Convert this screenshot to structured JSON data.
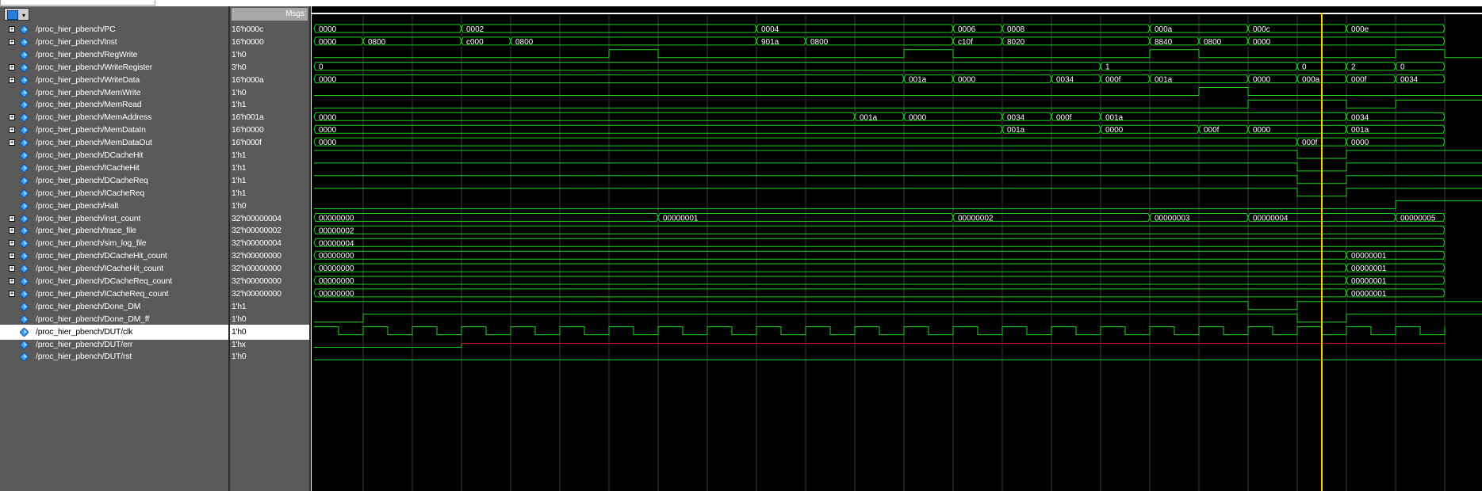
{
  "header": {
    "msgs_label": "Msgs"
  },
  "colors": {
    "wave": "#1fd21f",
    "cursor": "#ffcc00",
    "xstate": "#c81414",
    "grid": "#3c3c3c"
  },
  "signals": [
    {
      "name": "/proc_hier_pbench/PC",
      "value": "16'h000c",
      "expandable": true
    },
    {
      "name": "/proc_hier_pbench/Inst",
      "value": "16'h0000",
      "expandable": true
    },
    {
      "name": "/proc_hier_pbench/RegWrite",
      "value": "1'h0",
      "expandable": false
    },
    {
      "name": "/proc_hier_pbench/WriteRegister",
      "value": "3'h0",
      "expandable": true
    },
    {
      "name": "/proc_hier_pbench/WriteData",
      "value": "16'h000a",
      "expandable": true
    },
    {
      "name": "/proc_hier_pbench/MemWrite",
      "value": "1'h0",
      "expandable": false
    },
    {
      "name": "/proc_hier_pbench/MemRead",
      "value": "1'h1",
      "expandable": false
    },
    {
      "name": "/proc_hier_pbench/MemAddress",
      "value": "16'h001a",
      "expandable": true
    },
    {
      "name": "/proc_hier_pbench/MemDataIn",
      "value": "16'h0000",
      "expandable": true
    },
    {
      "name": "/proc_hier_pbench/MemDataOut",
      "value": "16'h000f",
      "expandable": true
    },
    {
      "name": "/proc_hier_pbench/DCacheHit",
      "value": "1'h1",
      "expandable": false
    },
    {
      "name": "/proc_hier_pbench/ICacheHit",
      "value": "1'h1",
      "expandable": false
    },
    {
      "name": "/proc_hier_pbench/DCacheReq",
      "value": "1'h1",
      "expandable": false
    },
    {
      "name": "/proc_hier_pbench/ICacheReq",
      "value": "1'h1",
      "expandable": false
    },
    {
      "name": "/proc_hier_pbench/Halt",
      "value": "1'h0",
      "expandable": false
    },
    {
      "name": "/proc_hier_pbench/inst_count",
      "value": "32'h00000004",
      "expandable": true
    },
    {
      "name": "/proc_hier_pbench/trace_file",
      "value": "32'h00000002",
      "expandable": true
    },
    {
      "name": "/proc_hier_pbench/sim_log_file",
      "value": "32'h00000004",
      "expandable": true
    },
    {
      "name": "/proc_hier_pbench/DCacheHit_count",
      "value": "32'h00000000",
      "expandable": true
    },
    {
      "name": "/proc_hier_pbench/ICacheHit_count",
      "value": "32'h00000000",
      "expandable": true
    },
    {
      "name": "/proc_hier_pbench/DCacheReq_count",
      "value": "32'h00000000",
      "expandable": true
    },
    {
      "name": "/proc_hier_pbench/ICacheReq_count",
      "value": "32'h00000000",
      "expandable": true
    },
    {
      "name": "/proc_hier_pbench/Done_DM",
      "value": "1'h1",
      "expandable": false
    },
    {
      "name": "/proc_hier_pbench/Done_DM_ff",
      "value": "1'h0",
      "expandable": false
    },
    {
      "name": "/proc_hier_pbench/DUT/clk",
      "value": "1'h0",
      "expandable": false,
      "selected": true
    },
    {
      "name": "/proc_hier_pbench/DUT/err",
      "value": "1'hx",
      "expandable": false
    },
    {
      "name": "/proc_hier_pbench/DUT/rst",
      "value": "1'h0",
      "expandable": false
    }
  ],
  "waves": [
    {
      "kind": "bus",
      "segments": [
        [
          "0000",
          0
        ],
        [
          "0002",
          3
        ],
        [
          "0004",
          9
        ],
        [
          "0006",
          13
        ],
        [
          "0008",
          14
        ],
        [
          "000a",
          17
        ],
        [
          "000c",
          19
        ],
        [
          "000e",
          21
        ]
      ]
    },
    {
      "kind": "bus",
      "segments": [
        [
          "0000",
          0
        ],
        [
          "0800",
          1
        ],
        [
          "c000",
          3
        ],
        [
          "0800",
          4
        ],
        [
          "901a",
          9
        ],
        [
          "0800",
          10
        ],
        [
          "c10f",
          13
        ],
        [
          "8020",
          14
        ],
        [
          "8840",
          17
        ],
        [
          "0800",
          18
        ],
        [
          "0000",
          19
        ]
      ]
    },
    {
      "kind": "bit",
      "levels": [
        0,
        0,
        0,
        0,
        0,
        0,
        1,
        0,
        0,
        0,
        0,
        0,
        1,
        0,
        0,
        0,
        0,
        1,
        0,
        0,
        0,
        0,
        1,
        0
      ]
    },
    {
      "kind": "bus",
      "segments": [
        [
          "0",
          0
        ],
        [
          "1",
          16
        ],
        [
          "0",
          20
        ],
        [
          "2",
          21
        ],
        [
          "0",
          22
        ]
      ]
    },
    {
      "kind": "bus",
      "segments": [
        [
          "0000",
          0
        ],
        [
          "001a",
          12
        ],
        [
          "0000",
          13
        ],
        [
          "0034",
          15
        ],
        [
          "000f",
          16
        ],
        [
          "001a",
          17
        ],
        [
          "0000",
          19
        ],
        [
          "000a",
          20
        ],
        [
          "000f",
          21
        ],
        [
          "0034",
          22
        ]
      ]
    },
    {
      "kind": "bit",
      "levels": [
        0,
        0,
        0,
        0,
        0,
        0,
        0,
        0,
        0,
        0,
        0,
        0,
        0,
        0,
        0,
        0,
        0,
        0,
        1,
        0,
        0,
        0,
        0,
        0
      ]
    },
    {
      "kind": "bit",
      "levels": [
        0,
        0,
        0,
        0,
        0,
        0,
        0,
        0,
        0,
        0,
        0,
        0,
        0,
        0,
        0,
        0,
        0,
        0,
        0,
        1,
        1,
        0,
        1,
        1
      ]
    },
    {
      "kind": "bus",
      "segments": [
        [
          "0000",
          0
        ],
        [
          "001a",
          11
        ],
        [
          "0000",
          12
        ],
        [
          "0034",
          14
        ],
        [
          "000f",
          15
        ],
        [
          "001a",
          16
        ],
        [
          "0034",
          21
        ]
      ]
    },
    {
      "kind": "bus",
      "segments": [
        [
          "0000",
          0
        ],
        [
          "001a",
          14
        ],
        [
          "0000",
          16
        ],
        [
          "000f",
          18
        ],
        [
          "0000",
          19
        ],
        [
          "001a",
          21
        ]
      ]
    },
    {
      "kind": "bus",
      "segments": [
        [
          "0000",
          0
        ],
        [
          "000f",
          20
        ],
        [
          "0000",
          21
        ]
      ]
    },
    {
      "kind": "bit",
      "levels": [
        1,
        1,
        1,
        1,
        1,
        1,
        1,
        1,
        1,
        1,
        1,
        1,
        1,
        1,
        1,
        1,
        1,
        1,
        1,
        1,
        0,
        1,
        1,
        1
      ]
    },
    {
      "kind": "bit",
      "levels": [
        1,
        1,
        1,
        1,
        1,
        1,
        1,
        1,
        1,
        1,
        1,
        1,
        1,
        1,
        1,
        1,
        1,
        1,
        1,
        1,
        0,
        1,
        1,
        1
      ]
    },
    {
      "kind": "bit",
      "levels": [
        1,
        1,
        1,
        1,
        1,
        1,
        1,
        1,
        1,
        1,
        1,
        1,
        1,
        1,
        1,
        1,
        1,
        1,
        1,
        1,
        0,
        1,
        1,
        1
      ]
    },
    {
      "kind": "bit",
      "levels": [
        1,
        1,
        1,
        1,
        1,
        1,
        1,
        1,
        1,
        1,
        1,
        1,
        1,
        1,
        1,
        1,
        1,
        1,
        1,
        1,
        0,
        1,
        1,
        1
      ]
    },
    {
      "kind": "bit",
      "levels": [
        0,
        0,
        0,
        0,
        0,
        0,
        0,
        0,
        0,
        0,
        0,
        0,
        0,
        0,
        0,
        0,
        0,
        0,
        0,
        0,
        0,
        0,
        1,
        1
      ]
    },
    {
      "kind": "bus",
      "segments": [
        [
          "00000000",
          0
        ],
        [
          "00000001",
          7
        ],
        [
          "00000002",
          13
        ],
        [
          "00000003",
          17
        ],
        [
          "00000004",
          19
        ],
        [
          "00000005",
          22
        ]
      ]
    },
    {
      "kind": "bus",
      "segments": [
        [
          "00000002",
          0
        ]
      ]
    },
    {
      "kind": "bus",
      "segments": [
        [
          "00000004",
          0
        ]
      ]
    },
    {
      "kind": "bus",
      "segments": [
        [
          "00000000",
          0
        ],
        [
          "00000001",
          21
        ]
      ]
    },
    {
      "kind": "bus",
      "segments": [
        [
          "00000000",
          0
        ],
        [
          "00000001",
          21
        ]
      ]
    },
    {
      "kind": "bus",
      "segments": [
        [
          "00000000",
          0
        ],
        [
          "00000001",
          21
        ]
      ]
    },
    {
      "kind": "bus",
      "segments": [
        [
          "00000000",
          0
        ],
        [
          "00000001",
          21
        ]
      ]
    },
    {
      "kind": "bit",
      "levels": [
        1,
        1,
        1,
        1,
        1,
        1,
        1,
        1,
        1,
        1,
        1,
        1,
        1,
        1,
        1,
        1,
        1,
        1,
        1,
        0,
        1,
        1,
        1,
        1
      ]
    },
    {
      "kind": "bit",
      "levels": [
        0,
        1,
        1,
        1,
        1,
        1,
        1,
        1,
        1,
        1,
        1,
        1,
        1,
        1,
        1,
        1,
        1,
        1,
        1,
        1,
        0,
        1,
        1,
        1
      ]
    },
    {
      "kind": "clk"
    },
    {
      "kind": "err"
    },
    {
      "kind": "bit",
      "levels": [
        0,
        0,
        0,
        0,
        0,
        0,
        0,
        0,
        0,
        0,
        0,
        0,
        0,
        0,
        0,
        0,
        0,
        0,
        0,
        0,
        0,
        0,
        0,
        0
      ]
    }
  ],
  "timeline": {
    "cycles": 23,
    "cursor_cycle": 20.5
  }
}
